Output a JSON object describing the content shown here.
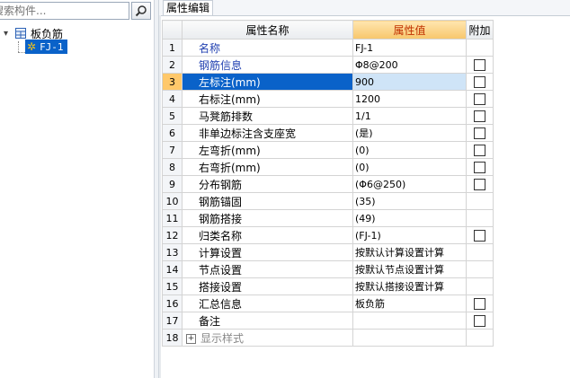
{
  "search": {
    "placeholder": "搜索构件..."
  },
  "tree": {
    "root_expander": "▾",
    "root_label": "板负筋",
    "child_label": "FJ-1"
  },
  "tab": {
    "label": "属性编辑"
  },
  "grid": {
    "headers": {
      "name": "属性名称",
      "value": "属性值",
      "extra": "附加"
    },
    "rows": [
      {
        "num": "1",
        "name": "名称",
        "value": "FJ-1",
        "checkbox": false,
        "blue": true
      },
      {
        "num": "2",
        "name": "钢筋信息",
        "value": "Φ8@200",
        "checkbox": true,
        "blue": true
      },
      {
        "num": "3",
        "name": "左标注(mm)",
        "value": "900",
        "checkbox": true,
        "selected": true
      },
      {
        "num": "4",
        "name": "右标注(mm)",
        "value": "1200",
        "checkbox": true
      },
      {
        "num": "5",
        "name": "马凳筋排数",
        "value": "1/1",
        "checkbox": true
      },
      {
        "num": "6",
        "name": "非单边标注含支座宽",
        "value": "(是)",
        "checkbox": true
      },
      {
        "num": "7",
        "name": "左弯折(mm)",
        "value": "(0)",
        "checkbox": true
      },
      {
        "num": "8",
        "name": "右弯折(mm)",
        "value": "(0)",
        "checkbox": true
      },
      {
        "num": "9",
        "name": "分布钢筋",
        "value": "(Φ6@250)",
        "checkbox": true
      },
      {
        "num": "10",
        "name": "钢筋锚固",
        "value": "(35)",
        "checkbox": false
      },
      {
        "num": "11",
        "name": "钢筋搭接",
        "value": "(49)",
        "checkbox": false
      },
      {
        "num": "12",
        "name": "归类名称",
        "value": "(FJ-1)",
        "checkbox": true
      },
      {
        "num": "13",
        "name": "计算设置",
        "value": "按默认计算设置计算",
        "checkbox": false
      },
      {
        "num": "14",
        "name": "节点设置",
        "value": "按默认节点设置计算",
        "checkbox": false
      },
      {
        "num": "15",
        "name": "搭接设置",
        "value": "按默认搭接设置计算",
        "checkbox": false
      },
      {
        "num": "16",
        "name": "汇总信息",
        "value": "板负筋",
        "checkbox": true
      },
      {
        "num": "17",
        "name": "备注",
        "value": "",
        "checkbox": true
      },
      {
        "num": "18",
        "name": "显示样式",
        "value": "",
        "checkbox": false,
        "expandable": true,
        "expander": "+"
      }
    ]
  },
  "colors": {
    "selection": "#0a62c9",
    "header_highlight": "#f7c66b",
    "blue_text": "#1f3fb0"
  }
}
